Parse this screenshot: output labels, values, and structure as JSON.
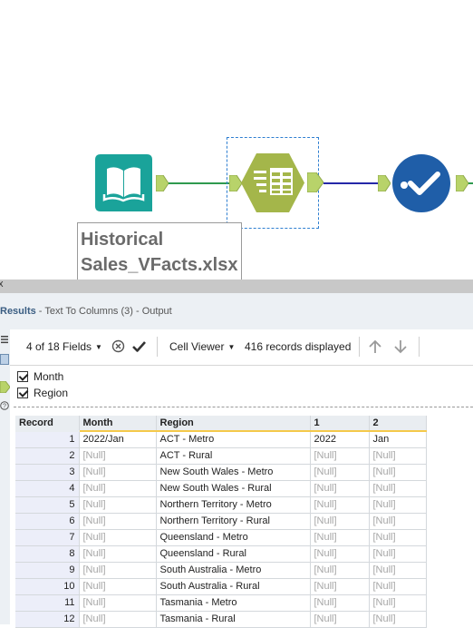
{
  "canvas": {
    "input_tool_label_line1": "Historical",
    "input_tool_label_line2": "Sales_VFacts.xlsx",
    "colors": {
      "input_icon": "#1aa39a",
      "text_to_columns_icon": "#a4b64a",
      "check_icon": "#1f5ea8",
      "wire_green": "#2f9a4f",
      "wire_blue": "#2528a8",
      "connector": "#b8d36a"
    }
  },
  "splitter": {
    "close_glyph": "x"
  },
  "results": {
    "title": "Results",
    "subtitle": " - Text To Columns (3) - Output"
  },
  "toolbar": {
    "fields_label": "4 of 18 Fields",
    "viewer_label": "Cell Viewer",
    "records_label": "416 records displayed"
  },
  "field_list": [
    "Month",
    "Region"
  ],
  "grid": {
    "columns": [
      "Record",
      "Month",
      "Region",
      "1",
      "2"
    ],
    "rows": [
      [
        "1",
        "2022/Jan",
        "ACT - Metro",
        "2022",
        "Jan"
      ],
      [
        "2",
        "[Null]",
        "ACT - Rural",
        "[Null]",
        "[Null]"
      ],
      [
        "3",
        "[Null]",
        "New South Wales - Metro",
        "[Null]",
        "[Null]"
      ],
      [
        "4",
        "[Null]",
        "New South Wales - Rural",
        "[Null]",
        "[Null]"
      ],
      [
        "5",
        "[Null]",
        "Northern Territory - Metro",
        "[Null]",
        "[Null]"
      ],
      [
        "6",
        "[Null]",
        "Northern Territory - Rural",
        "[Null]",
        "[Null]"
      ],
      [
        "7",
        "[Null]",
        "Queensland - Metro",
        "[Null]",
        "[Null]"
      ],
      [
        "8",
        "[Null]",
        "Queensland - Rural",
        "[Null]",
        "[Null]"
      ],
      [
        "9",
        "[Null]",
        "South Australia - Metro",
        "[Null]",
        "[Null]"
      ],
      [
        "10",
        "[Null]",
        "South Australia - Rural",
        "[Null]",
        "[Null]"
      ],
      [
        "11",
        "[Null]",
        "Tasmania - Metro",
        "[Null]",
        "[Null]"
      ],
      [
        "12",
        "[Null]",
        "Tasmania - Rural",
        "[Null]",
        "[Null]"
      ]
    ]
  }
}
